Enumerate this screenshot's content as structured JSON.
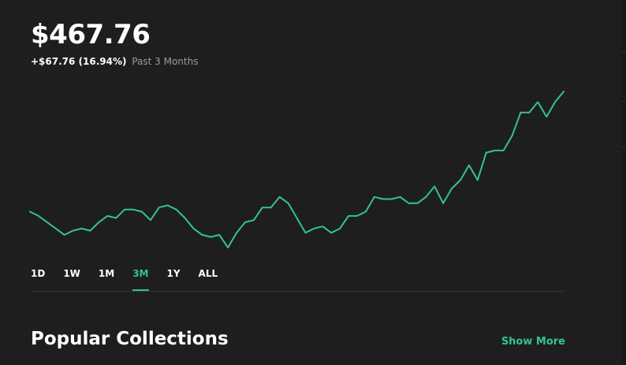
{
  "header": {
    "value": "$467.76",
    "change": "+$67.76 (16.94%)",
    "period": "Past 3 Months"
  },
  "colors": {
    "accent": "#33c48d",
    "background": "#1e1e1f",
    "text_secondary": "#9c9ca0",
    "divider": "#343437"
  },
  "range_tabs": [
    {
      "label": "1D",
      "active": false
    },
    {
      "label": "1W",
      "active": false
    },
    {
      "label": "1M",
      "active": false
    },
    {
      "label": "3M",
      "active": true
    },
    {
      "label": "1Y",
      "active": false
    },
    {
      "label": "ALL",
      "active": false
    }
  ],
  "collections": {
    "title": "Popular Collections",
    "show_more": "Show More"
  },
  "chart_data": {
    "type": "line",
    "values": [
      403,
      401,
      398,
      395,
      392,
      394,
      395,
      394,
      398,
      401,
      400,
      404,
      404,
      403,
      399,
      405,
      406,
      404,
      400,
      395,
      392,
      391,
      392,
      386,
      393,
      398,
      399,
      405,
      405,
      410,
      407,
      400,
      393,
      395,
      396,
      393,
      395,
      401,
      401,
      403,
      410,
      409,
      409,
      410,
      407,
      407,
      410,
      415,
      407,
      414,
      418,
      425,
      418,
      431,
      432,
      432,
      439,
      450,
      450,
      455,
      448,
      455,
      460
    ],
    "grid": false
  }
}
